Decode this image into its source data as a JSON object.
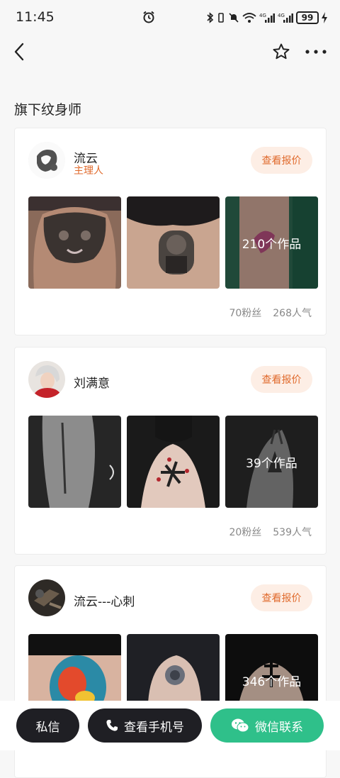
{
  "status_bar": {
    "time": "11:45",
    "battery": "99"
  },
  "nav": {
    "back_icon": "chevron-left-icon",
    "favorite_icon": "star-icon",
    "more_icon": "more-dots-icon"
  },
  "section_title": "旗下纹身师",
  "artists": [
    {
      "name": "流云",
      "role": "主理人",
      "quote_label": "查看报价",
      "works_label": "210个作品",
      "fans": "70粉丝",
      "popularity": "268人气"
    },
    {
      "name": "刘满意",
      "role": "",
      "quote_label": "查看报价",
      "works_label": "39个作品",
      "fans": "20粉丝",
      "popularity": "539人气"
    },
    {
      "name": "流云---心刺",
      "role": "",
      "quote_label": "查看报价",
      "works_label": "346个作品"
    }
  ],
  "bottom_bar": {
    "message_label": "私信",
    "phone_label": "查看手机号",
    "wechat_label": "微信联系"
  },
  "colors": {
    "accent": "#e06a2c",
    "accent_bg": "#fdeee5",
    "wechat_green": "#2fc08a",
    "dark_button": "#1f1f24"
  }
}
